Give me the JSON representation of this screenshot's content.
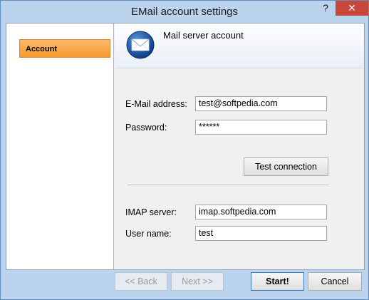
{
  "window": {
    "title": "EMail account settings",
    "help_glyph": "?",
    "close_glyph": "✕"
  },
  "sidebar": {
    "items": [
      {
        "label": "Account",
        "selected": true
      }
    ]
  },
  "header": {
    "title": "Mail server account",
    "icon": "envelope-icon"
  },
  "form": {
    "email_label": "E-Mail address:",
    "email_value": "test@softpedia.com",
    "password_label": "Password:",
    "password_value": "******",
    "test_connection_label": "Test connection",
    "imap_label": "IMAP server:",
    "imap_value": "imap.softpedia.com",
    "username_label": "User name:",
    "username_value": "test"
  },
  "footer": {
    "back_label": "<< Back",
    "next_label": "Next >>",
    "start_label": "Start!",
    "cancel_label": "Cancel"
  },
  "colors": {
    "accent": "#f79a2e",
    "frame": "#bcd3ed",
    "close": "#c7483b"
  }
}
